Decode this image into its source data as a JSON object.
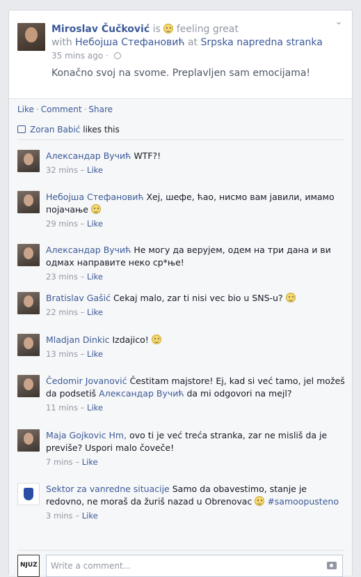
{
  "post": {
    "author": "Miroslav Čučković",
    "is_text": "is",
    "feeling_text": "feeling great",
    "with_text": "with",
    "tagged": "Небојша Стефановић",
    "at_text": "at",
    "place": "Srpska napredna stranka",
    "time": "35 mins ago",
    "status": "Konačno svoj na svome. Preplavljen sam emocijama!"
  },
  "actions": {
    "like": "Like",
    "comment": "Comment",
    "share": "Share",
    "separator": "·"
  },
  "likes": {
    "name": "Zoran Babić",
    "suffix": "likes this"
  },
  "comments": [
    {
      "author": "Александар Вучић",
      "text": "WTF?!",
      "time": "32 mins",
      "like": "Like"
    },
    {
      "author": "Небојша Стефановић",
      "text": "Хеј, шефе, ћао, нисмо вам јавили, имамо појачање",
      "time": "29 mins",
      "like": "Like"
    },
    {
      "author": "Александар Вучић",
      "text": "Не могу да верујем, одем на три дана и ви одмах направите неко ср*ње!",
      "time": "23 mins",
      "like": "Like"
    },
    {
      "author": "Bratislav Gašić",
      "text": "Cekaj malo, zar ti nisi vec bio u SNS-u?",
      "time": "22 mins",
      "like": "Like"
    },
    {
      "author": "Mladjan Dinkic",
      "text": "Izdajico!",
      "time": "13 mins",
      "like": "Like"
    },
    {
      "author": "Čedomir Jovanović",
      "text_before": "Čestitam majstore! Ej, kad si već tamo, jel možeš da podsetiš",
      "mention": "Александар Вучић",
      "text_after": "da mi odgovori na mejl?",
      "time": "11 mins",
      "like": "Like"
    },
    {
      "author": "Maja Gojkovic Hm,",
      "text": "ovo ti je već treća stranka, zar ne misliš da je previše? Uspori malo čoveče!",
      "time": "7 mins",
      "like": "Like"
    },
    {
      "author": "Sektor za vanredne situacije",
      "text": "Samo da obavestimo, stanje je redovno, ne moraš da žuriš nazad u Obrenovac",
      "hashtag": "#samoopusteno",
      "time": "3 mins",
      "like": "Like"
    }
  ],
  "time_sep": "–",
  "composer": {
    "placeholder": "Write a comment...",
    "avatar_text": "NJUZ"
  }
}
